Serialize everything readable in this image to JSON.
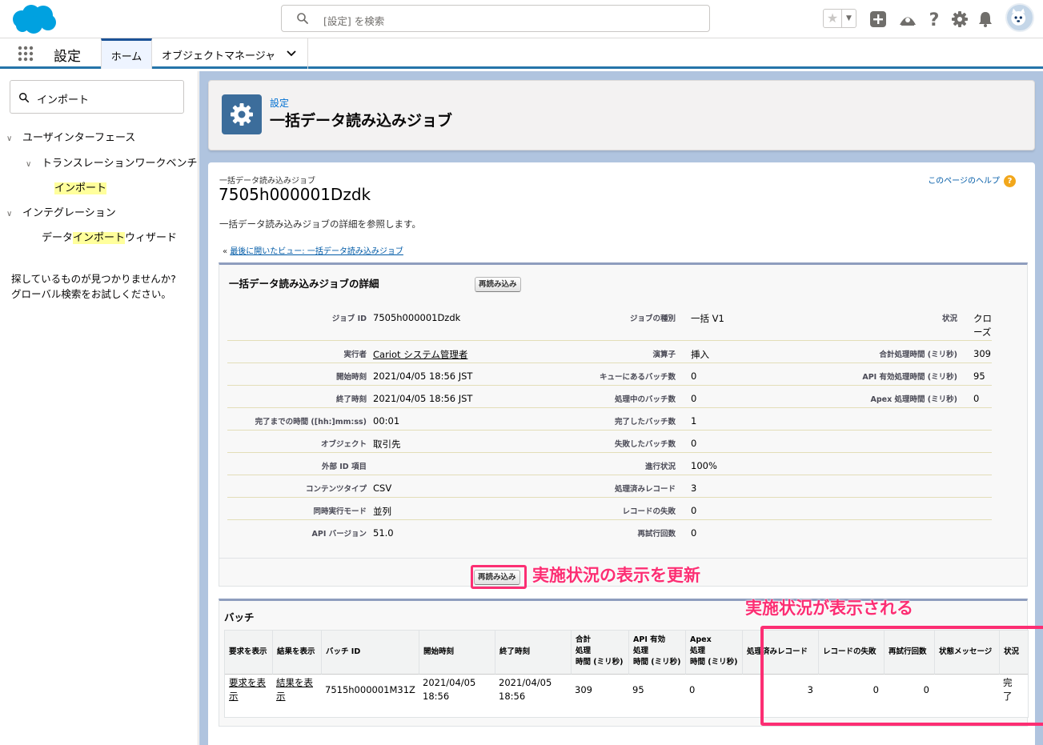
{
  "header": {
    "search_placeholder": "[設定] を検索",
    "icons": [
      "salesforce-cloud-logo",
      "search-icon",
      "star-icon",
      "add-icon",
      "trailhead-icon",
      "help-icon",
      "gear-icon",
      "bell-icon",
      "avatar"
    ]
  },
  "nav": {
    "app_name": "設定",
    "tabs": [
      {
        "label": "ホーム",
        "selected": true
      },
      {
        "label": "オブジェクトマネージャ",
        "selected": false
      }
    ]
  },
  "sidebar": {
    "quick_find_value": "インポート",
    "tree": {
      "ui": "ユーザインターフェース",
      "translation": "トランスレーションワークベンチ",
      "import_hl": "インポート",
      "integration": "インテグレーション",
      "wizard_pre": "データ",
      "wizard_hl": "インポート",
      "wizard_post": "ウィザード"
    },
    "hint_line1": "探しているものが見つかりませんか?",
    "hint_line2": "グローバル検索をお試しください。"
  },
  "page_header": {
    "breadcrumb": "設定",
    "title": "一括データ読み込みジョブ"
  },
  "content": {
    "type_label": "一括データ読み込みジョブ",
    "record_name": "7505h000001Dzdk",
    "help_link": "このページのヘルプ",
    "description": "一括データ読み込みジョブの詳細を参照します。",
    "back_prefix": "«",
    "back_link": "最後に開いたビュー: 一括データ読み込みジョブ"
  },
  "detail": {
    "title": "一括データ読み込みジョブの詳細",
    "reload_label": "再読み込み",
    "rows": [
      {
        "l1": "ジョブ ID",
        "v1": "7505h000001Dzdk",
        "l2": "ジョブの種別",
        "v2": "一括 V1",
        "l3": "状況",
        "v3a": "クロ",
        "v3b": "ーズ"
      },
      {
        "l1": "実行者",
        "v1": "Cariot システム管理者",
        "l2": "演算子",
        "v2": "挿入",
        "l3": "合計処理時間 (ミリ秒)",
        "v3a": "309"
      },
      {
        "l1": "開始時刻",
        "v1": "2021/04/05 18:56 JST",
        "l2": "キューにあるバッチ数",
        "v2": "0",
        "l3": "API 有効処理時間 (ミリ秒)",
        "v3a": "95"
      },
      {
        "l1": "終了時刻",
        "v1": "2021/04/05 18:56 JST",
        "l2": "処理中のバッチ数",
        "v2": "0",
        "l3": "Apex 処理時間 (ミリ秒)",
        "v3a": "0"
      },
      {
        "l1": "完了までの時間 ([hh:]mm:ss)",
        "v1": "00:01",
        "l2": "完了したバッチ数",
        "v2": "1"
      },
      {
        "l1": "オブジェクト",
        "v1": "取引先",
        "l2": "失敗したバッチ数",
        "v2": "0"
      },
      {
        "l1": "外部 ID 項目",
        "v1": "",
        "l2": "進行状況",
        "v2": "100%"
      },
      {
        "l1": "コンテンツタイプ",
        "v1": "CSV",
        "l2": "処理済みレコード",
        "v2": "3"
      },
      {
        "l1": "同時実行モード",
        "v1": "並列",
        "l2": "レコードの失敗",
        "v2": "0"
      },
      {
        "l1": "API バージョン",
        "v1": "51.0",
        "l2": "再試行回数",
        "v2": "0"
      }
    ]
  },
  "annotation": {
    "refresh_note": "実施状況の表示を更新",
    "status_note": "実施状況が表示される"
  },
  "batch": {
    "title": "バッチ",
    "headers": [
      {
        "a": "要求を表示"
      },
      {
        "a": "結果を表示"
      },
      {
        "a": "バッチ ID"
      },
      {
        "a": "開始時刻"
      },
      {
        "a": "終了時刻"
      },
      {
        "a": "合計",
        "b": "処理",
        "c": "時間 (ミリ秒)"
      },
      {
        "a": "API 有効",
        "b": "処理",
        "c": "時間 (ミリ秒)"
      },
      {
        "a": "Apex",
        "b": "処理",
        "c": "時間 (ミリ秒)"
      },
      {
        "a": "処理済みレコード"
      },
      {
        "a": "レコードの失敗"
      },
      {
        "a": "再試行回数"
      },
      {
        "a": "状態メッセージ"
      },
      {
        "a": "状況"
      }
    ],
    "row": {
      "req_a": "要求を表",
      "req_b": "示",
      "res_a": "結果を表",
      "res_b": "示",
      "batch_id": "7515h000001M31Z",
      "start_a": "2021/04/05",
      "start_b": "18:56",
      "end_a": "2021/04/05",
      "end_b": "18:56",
      "total": "309",
      "api": "95",
      "apex": "0",
      "processed": "3",
      "failed": "0",
      "retries": "0",
      "message": "",
      "status_a": "完",
      "status_b": "了"
    }
  },
  "colors": {
    "brand_blue": "#0070d2",
    "callout_pink": "#fc2e73",
    "highlight_yellow": "#ffff9c"
  }
}
